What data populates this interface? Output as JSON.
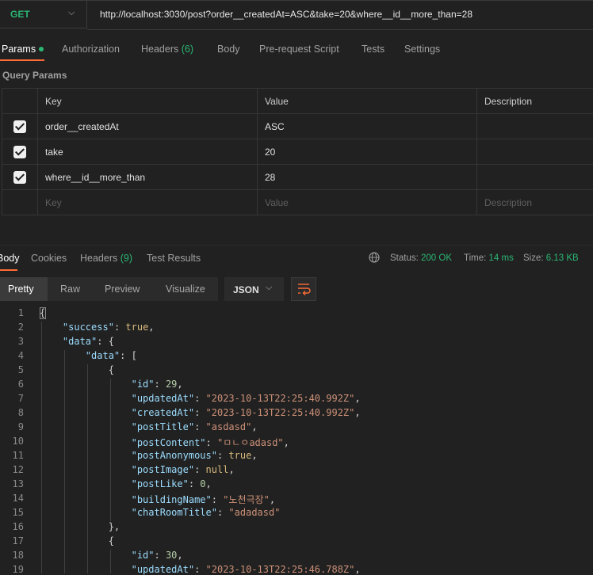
{
  "request": {
    "method": "GET",
    "url": "http://localhost:3030/post?order__createdAt=ASC&take=20&where__id__more_than=28"
  },
  "request_tabs": {
    "params": "Params",
    "authorization": "Authorization",
    "headers": "Headers",
    "headers_count": "(6)",
    "body": "Body",
    "prerequest": "Pre-request Script",
    "tests": "Tests",
    "settings": "Settings"
  },
  "query_params": {
    "title": "Query Params",
    "columns": {
      "key": "Key",
      "value": "Value",
      "description": "Description"
    },
    "rows": [
      {
        "key": "order__createdAt",
        "value": "ASC",
        "checked": true
      },
      {
        "key": "take",
        "value": "20",
        "checked": true
      },
      {
        "key": "where__id__more_than",
        "value": "28",
        "checked": true
      }
    ],
    "placeholder": {
      "key": "Key",
      "value": "Value",
      "description": "Description"
    }
  },
  "response": {
    "tabs": {
      "body": "Body",
      "cookies": "Cookies",
      "headers": "Headers",
      "headers_count": "(9)",
      "test_results": "Test Results"
    },
    "status_label": "Status:",
    "status_value": "200 OK",
    "time_label": "Time:",
    "time_value": "14 ms",
    "size_label": "Size:",
    "size_value": "6.13 KB",
    "views": {
      "pretty": "Pretty",
      "raw": "Raw",
      "preview": "Preview",
      "visualize": "Visualize"
    },
    "format": "JSON",
    "line_numbers": [
      "1",
      "2",
      "3",
      "4",
      "5",
      "6",
      "7",
      "8",
      "9",
      "10",
      "11",
      "12",
      "13",
      "14",
      "15",
      "16",
      "17",
      "18",
      "19"
    ]
  },
  "body_json": {
    "success_key": "\"success\"",
    "success_val": "true",
    "data_key": "\"data\"",
    "inner_data_key": "\"data\"",
    "item1": {
      "id": "29",
      "updatedAt": "\"2023-10-13T22:25:40.992Z\"",
      "createdAt": "\"2023-10-13T22:25:40.992Z\"",
      "postTitle": "\"asdasd\"",
      "postContent": "\"ㅁㄴㅇadasd\"",
      "postAnonymous": "true",
      "postImage": "null",
      "postLike": "0",
      "buildingName": "\"노천극장\"",
      "chatRoomTitle": "\"adadasd\""
    },
    "item2": {
      "id": "30",
      "updatedAt": "\"2023-10-13T22:25:46.788Z\""
    },
    "keys": {
      "id": "\"id\"",
      "updatedAt": "\"updatedAt\"",
      "createdAt": "\"createdAt\"",
      "postTitle": "\"postTitle\"",
      "postContent": "\"postContent\"",
      "postAnonymous": "\"postAnonymous\"",
      "postImage": "\"postImage\"",
      "postLike": "\"postLike\"",
      "buildingName": "\"buildingName\"",
      "chatRoomTitle": "\"chatRoomTitle\""
    }
  },
  "colors": {
    "accent": "#ff6c37",
    "success_green": "#2bb673",
    "background": "#212121"
  }
}
